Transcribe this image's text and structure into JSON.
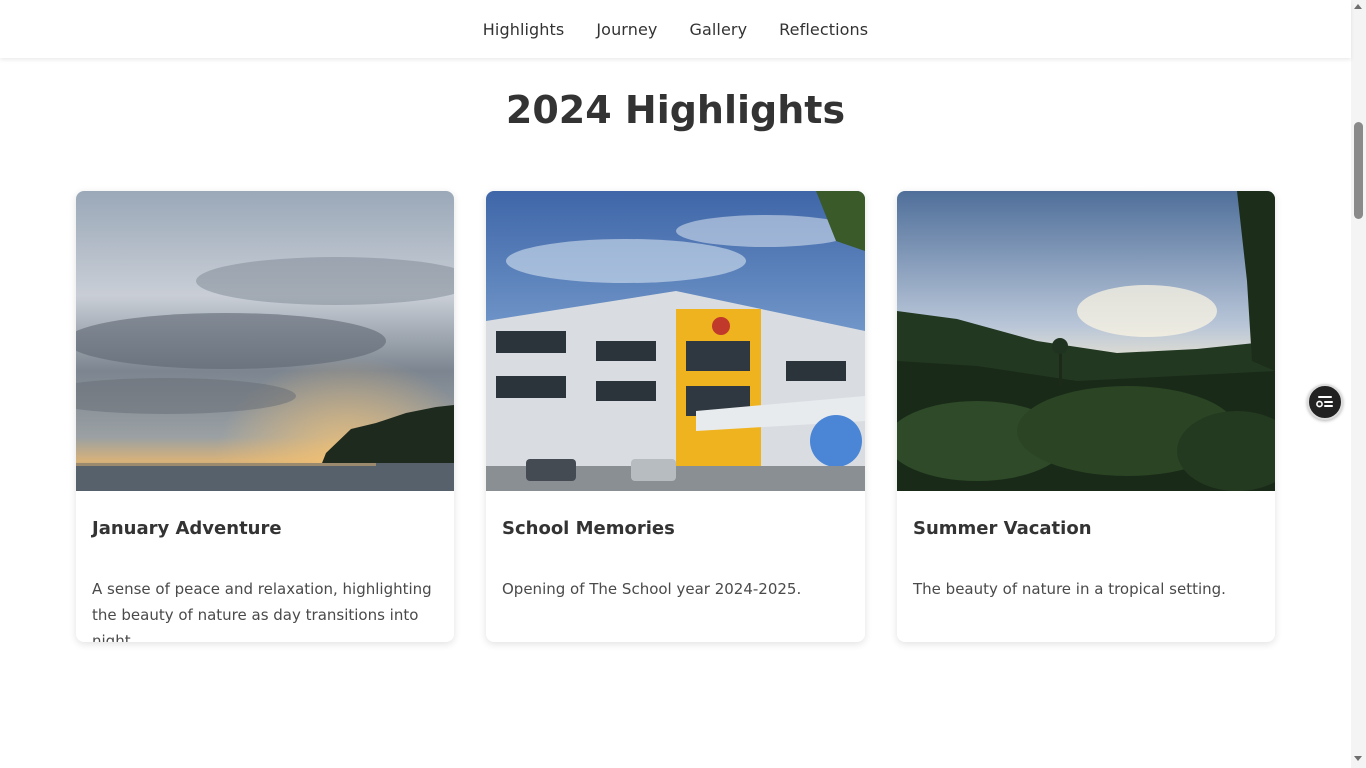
{
  "nav": {
    "items": [
      {
        "label": "Highlights"
      },
      {
        "label": "Journey"
      },
      {
        "label": "Gallery"
      },
      {
        "label": "Reflections"
      }
    ]
  },
  "main": {
    "title": "2024 Highlights",
    "cards": [
      {
        "title": "January Adventure",
        "description": "A sense of peace and relaxation, highlighting the beauty of nature as day transitions into night.",
        "image": "sunset-sea-clouds-photo"
      },
      {
        "title": "School Memories",
        "description": "Opening of The School year 2024-2025.",
        "image": "school-building-photo"
      },
      {
        "title": "Summer Vacation",
        "description": "The beauty of nature in a tropical setting.",
        "image": "tropical-forest-photo"
      }
    ]
  },
  "floating_button": {
    "icon": "toc-list-icon"
  },
  "colors": {
    "text": "#333333",
    "fab": "#222222",
    "background": "#ffffff"
  }
}
